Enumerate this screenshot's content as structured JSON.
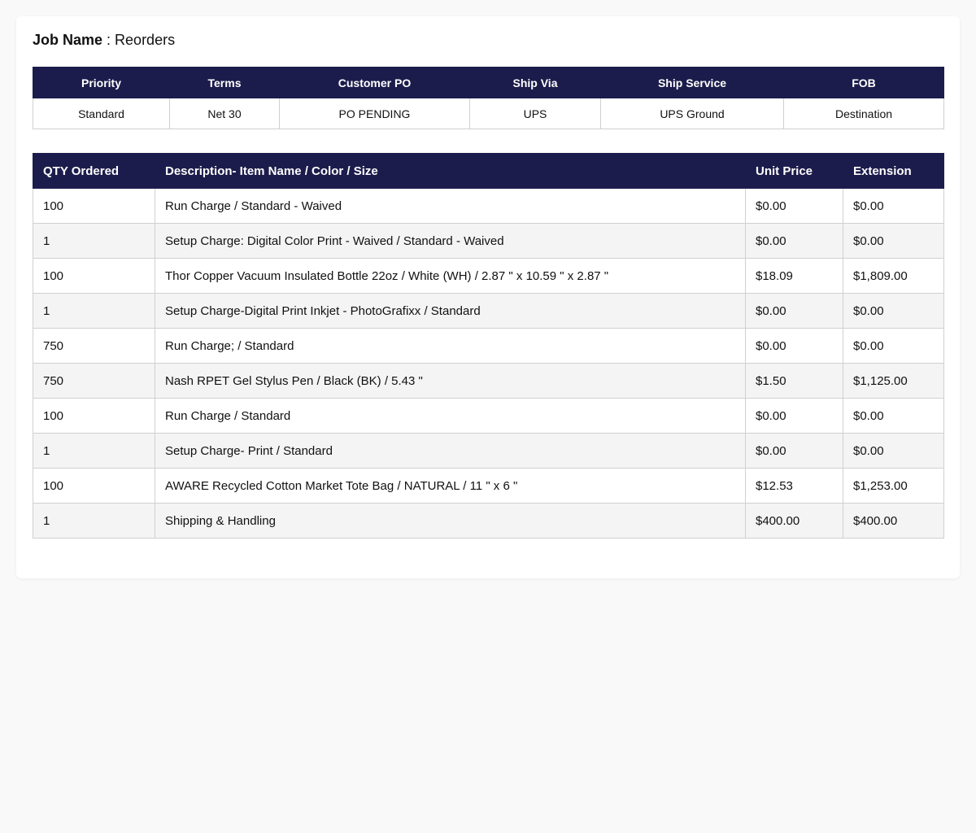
{
  "job": {
    "label": "Job Name",
    "separator": " : ",
    "value": "Reorders"
  },
  "info": {
    "headers": [
      "Priority",
      "Terms",
      "Customer PO",
      "Ship Via",
      "Ship Service",
      "FOB"
    ],
    "values": [
      "Standard",
      "Net 30",
      "PO PENDING",
      "UPS",
      "UPS Ground",
      "Destination"
    ]
  },
  "items": {
    "headers": [
      "QTY Ordered",
      "Description- Item Name / Color / Size",
      "Unit Price",
      "Extension"
    ],
    "rows": [
      {
        "qty": "100",
        "desc": "Run Charge / Standard - Waived",
        "unit": "$0.00",
        "ext": "$0.00"
      },
      {
        "qty": "1",
        "desc": "Setup Charge: Digital Color Print - Waived / Standard - Waived",
        "unit": "$0.00",
        "ext": "$0.00"
      },
      {
        "qty": "100",
        "desc": "Thor Copper Vacuum Insulated Bottle 22oz / White (WH) / 2.87 \" x 10.59 \" x 2.87 \"",
        "unit": "$18.09",
        "ext": "$1,809.00"
      },
      {
        "qty": "1",
        "desc": "Setup Charge-Digital Print Inkjet - PhotoGrafixx / Standard",
        "unit": "$0.00",
        "ext": "$0.00"
      },
      {
        "qty": "750",
        "desc": "Run Charge; / Standard",
        "unit": "$0.00",
        "ext": "$0.00"
      },
      {
        "qty": "750",
        "desc": "Nash RPET Gel Stylus Pen / Black (BK) / 5.43 \"",
        "unit": "$1.50",
        "ext": "$1,125.00"
      },
      {
        "qty": "100",
        "desc": "Run Charge / Standard",
        "unit": "$0.00",
        "ext": "$0.00"
      },
      {
        "qty": "1",
        "desc": "Setup Charge- Print / Standard",
        "unit": "$0.00",
        "ext": "$0.00"
      },
      {
        "qty": "100",
        "desc": "AWARE Recycled Cotton Market Tote Bag / NATURAL / 11 \" x 6 \"",
        "unit": "$12.53",
        "ext": "$1,253.00"
      },
      {
        "qty": "1",
        "desc": "Shipping & Handling",
        "unit": "$400.00",
        "ext": "$400.00"
      }
    ]
  }
}
